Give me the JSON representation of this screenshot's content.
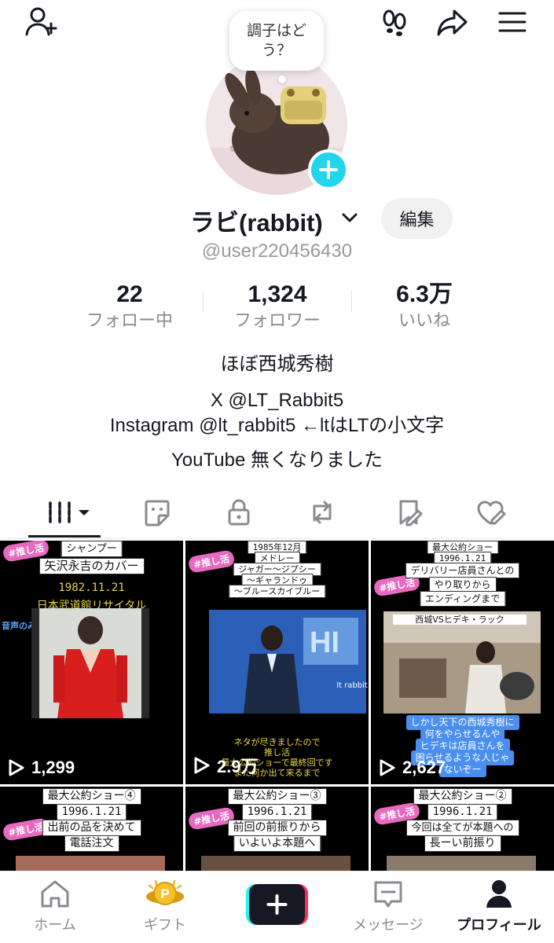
{
  "header": {
    "add_friend_icon": "person-plus-icon",
    "footprint_icon": "footprints-icon",
    "share_icon": "share-arrow-icon",
    "menu_icon": "hamburger-menu-icon"
  },
  "avatar": {
    "bubble_text": "調子はどう？",
    "add_badge_icon": "plus-icon"
  },
  "profile": {
    "name": "ラビ(rabbit)",
    "edit_label": "編集",
    "handle": "@user220456430"
  },
  "stats": [
    {
      "value": "22",
      "label": "フォロー中"
    },
    {
      "value": "1,324",
      "label": "フォロワー"
    },
    {
      "value": "6.3万",
      "label": "いいね"
    }
  ],
  "bio": {
    "line1": "ほぼ西城秀樹",
    "line2": "X @LT_Rabbit5",
    "line3": "Instagram @lt_rabbit5 ←ltはLTの小文字",
    "line4": "YouTube  無くなりました"
  },
  "tabs": [
    {
      "name": "videos-grid-tab",
      "icon": "grid-icon"
    },
    {
      "name": "stickers-tab",
      "icon": "sticker-icon"
    },
    {
      "name": "private-tab",
      "icon": "lock-icon"
    },
    {
      "name": "reposts-tab",
      "icon": "repost-icon"
    },
    {
      "name": "favorites-tab",
      "icon": "bookmark-icon"
    },
    {
      "name": "liked-tab",
      "icon": "heart-icon"
    }
  ],
  "videos": [
    {
      "caption": [
        "シャンプー",
        "矢沢永吉のカバー"
      ],
      "date": "1982.11.21",
      "subtitle": "日本武道館リサイタル",
      "side_note": "音声のみです",
      "tag": "#推し活",
      "views": "1,299"
    },
    {
      "caption": [
        "1985年12月",
        "メドレー",
        "ジャガー〜ジプシー",
        "〜ギャランドゥ",
        "〜ブルースカイブルー"
      ],
      "watermark": "lt rabbit",
      "note": [
        "ネタが尽きましたので",
        "推し活",
        "最大公約ショーで最終回です",
        "また何か出て来るまで"
      ],
      "tag": "#推し活",
      "views": "2.9万"
    },
    {
      "caption": [
        "最大公約ショー",
        "1996.1.21",
        "デリバリー店員さんとの",
        "やり取りから",
        "エンディングまで"
      ],
      "sign": "西城VSヒデキ・ラック",
      "blue_note": [
        "しかし天下の西城秀樹に",
        "何をやらせるんや",
        "ヒデキは店員さんを",
        "困らせるような人じゃ",
        "ないぞー"
      ],
      "tag": "#推し活",
      "views": "2,627"
    },
    {
      "caption": [
        "最大公約ショー④",
        "1996.1.21",
        "出前の品を決めて",
        "電話注文"
      ],
      "tag": "#推し活"
    },
    {
      "caption": [
        "最大公約ショー③",
        "1996.1.21",
        "前回の前振りから",
        "いよいよ本題へ"
      ],
      "tag": "#推し活"
    },
    {
      "caption": [
        "最大公約ショー②",
        "1996.1.21",
        "今回は全てが本題への",
        "長ーい前振り"
      ],
      "tag": "#推し活"
    }
  ],
  "bottom_nav": [
    {
      "label": "ホーム",
      "icon": "home-icon"
    },
    {
      "label": "ギフト",
      "icon": "gift-coin-icon"
    },
    {
      "label": "",
      "icon": "create-plus-icon"
    },
    {
      "label": "メッセージ",
      "icon": "message-icon"
    },
    {
      "label": "プロフィール",
      "icon": "profile-icon"
    }
  ],
  "colors": {
    "accent": "#20d5ec",
    "text": "#161823",
    "muted": "#8a8b91",
    "create_red": "#fe2c55",
    "create_cyan": "#25f4ee"
  }
}
